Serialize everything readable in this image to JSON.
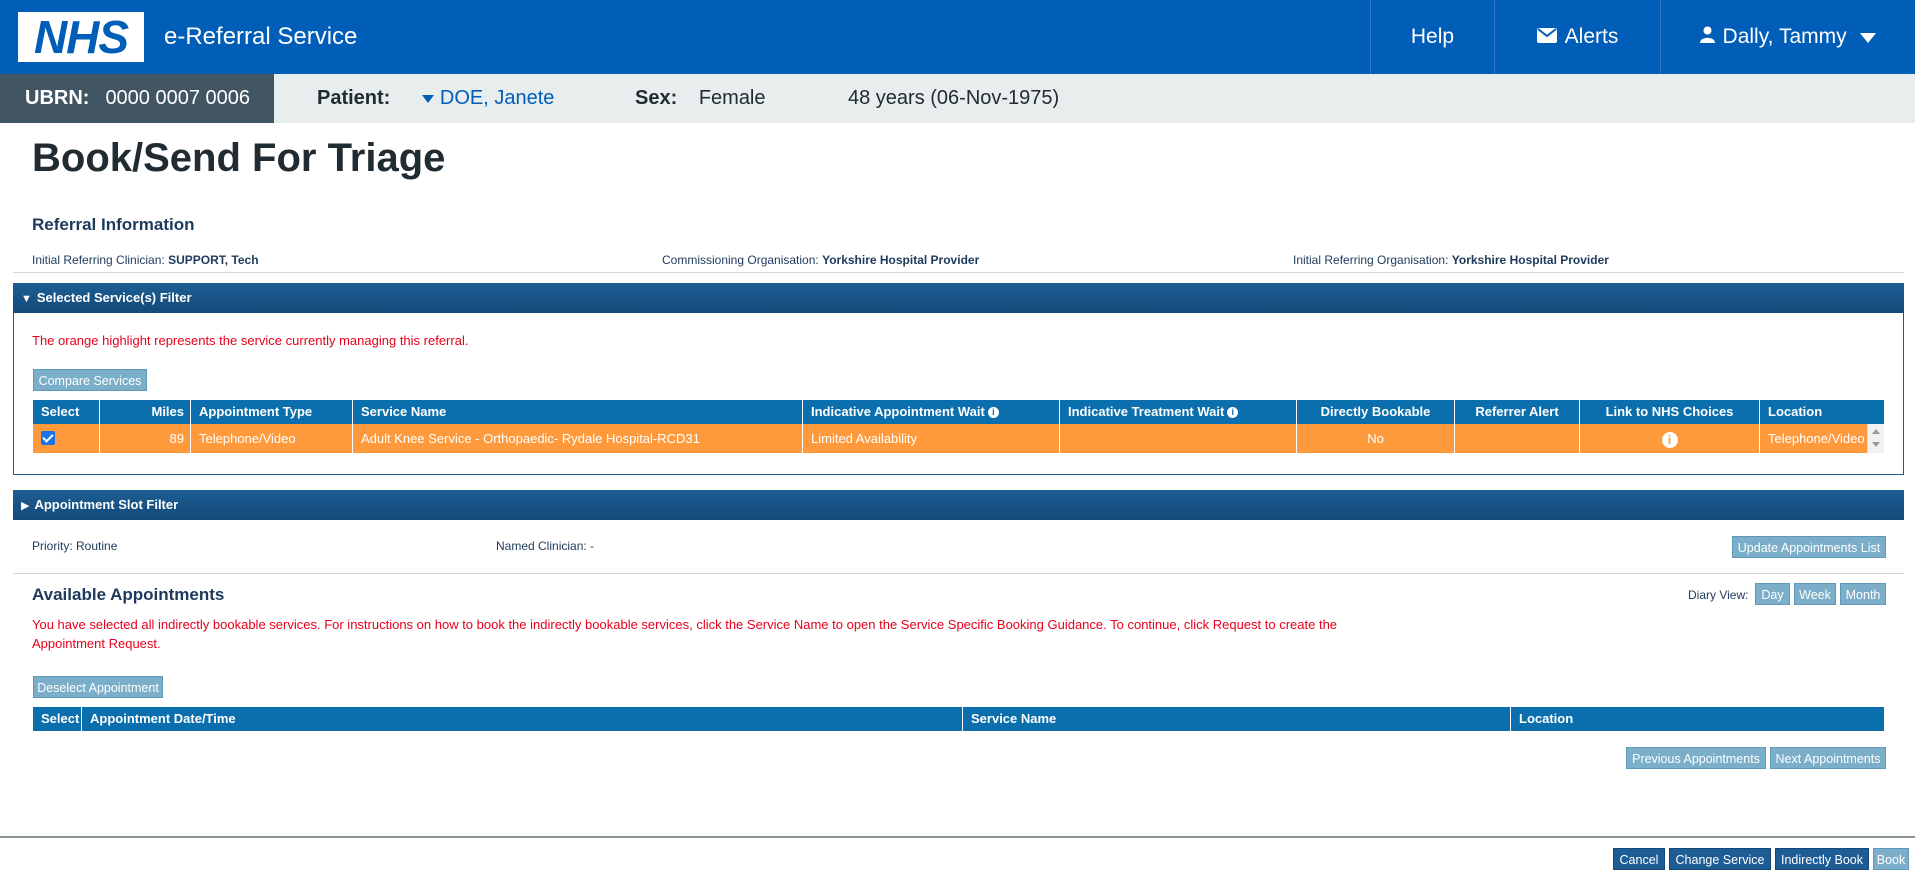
{
  "header": {
    "logo": "NHS",
    "app_title": "e-Referral Service",
    "help": "Help",
    "alerts": "Alerts",
    "user": "Dally, Tammy"
  },
  "patient_bar": {
    "ubrn_label": "UBRN:",
    "ubrn_value": "0000 0007 0006",
    "patient_label": "Patient:",
    "patient_name": "DOE, Janete",
    "sex_label": "Sex:",
    "sex_value": "Female",
    "age": "48 years (06-Nov-1975)"
  },
  "page_title": "Book/Send For Triage",
  "referral_info": {
    "heading": "Referral Information",
    "clinician_label": "Initial Referring Clinician:",
    "clinician_value": "SUPPORT, Tech",
    "commissioning_label": "Commissioning Organisation:",
    "commissioning_value": "Yorkshire Hospital Provider",
    "referring_org_label": "Initial Referring Organisation:",
    "referring_org_value": "Yorkshire Hospital Provider"
  },
  "services_filter": {
    "title": "Selected Service(s) Filter",
    "note": "The orange highlight represents the service currently managing this referral.",
    "compare_button": "Compare Services",
    "columns": [
      "Select",
      "Miles",
      "Appointment Type",
      "Service Name",
      "Indicative Appointment Wait",
      "Indicative Treatment Wait",
      "Directly Bookable",
      "Referrer Alert",
      "Link to NHS Choices",
      "Location"
    ],
    "rows": [
      {
        "miles": "89",
        "appointment_type": "Telephone/Video",
        "service_name": "Adult Knee Service - Orthopaedic- Rydale Hospital-RCD31",
        "appointment_wait": "Limited Availability",
        "treatment_wait": "",
        "directly_bookable": "No",
        "referrer_alert": "",
        "location": "Telephone/Video"
      }
    ]
  },
  "slot_filter": {
    "title": "Appointment Slot Filter",
    "priority": "Priority: Routine",
    "named_clinician": "Named Clinician: -",
    "update_button": "Update Appointments List"
  },
  "available": {
    "heading": "Available Appointments",
    "diary_label": "Diary View:",
    "diary_day": "Day",
    "diary_week": "Week",
    "diary_month": "Month",
    "note_line1": "You have selected all indirectly bookable services. For instructions on how to book the indirectly bookable services, click the Service Name to open the Service Specific Booking Guidance. To continue, click Request to create the",
    "note_line2": "Appointment Request.",
    "deselect_button": "Deselect Appointment",
    "columns": [
      "Select",
      "Appointment Date/Time",
      "Service Name",
      "Location"
    ],
    "prev_button": "Previous Appointments",
    "next_button": "Next Appointments"
  },
  "footer": {
    "cancel": "Cancel",
    "change_service": "Change Service",
    "indirectly_book": "Indirectly Book",
    "book": "Book"
  },
  "colors": {
    "nhs_blue": "#005eb8",
    "table_header": "#0a6fac",
    "highlight_orange": "#ff9a3c",
    "alert_red": "#e8001c"
  }
}
